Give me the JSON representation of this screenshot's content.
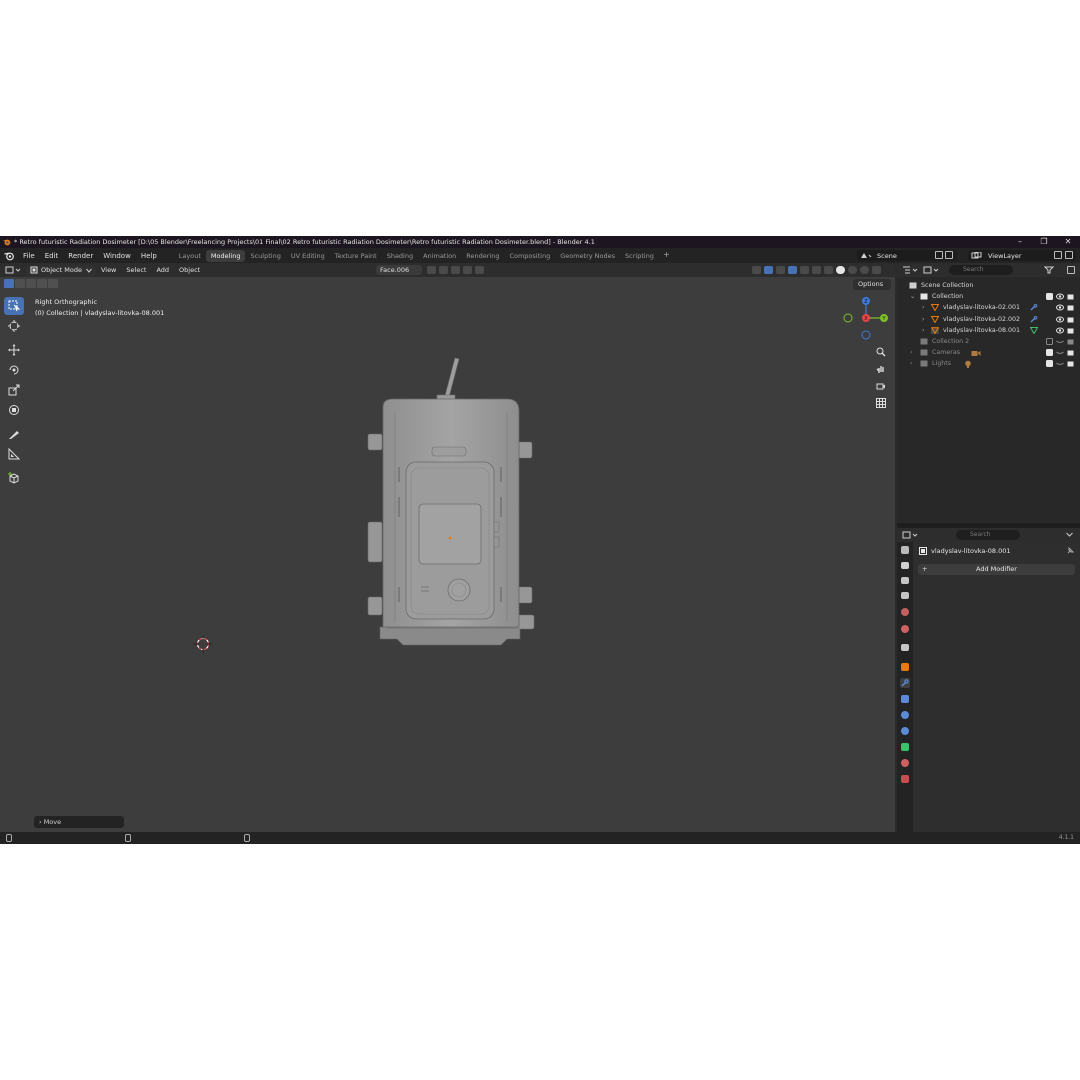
{
  "window": {
    "title": "* Retro futuristic Radiation Dosimeter [D:\\05 Blender\\Freelancing Projects\\01 Final\\02 Retro futuristic Radiation Dosimeter\\Retro futuristic Radiation Dosimeter.blend] - Blender 4.1",
    "controls": [
      "–",
      "❐",
      "✕"
    ]
  },
  "menu": [
    "File",
    "Edit",
    "Render",
    "Window",
    "Help"
  ],
  "workspaces": [
    "Layout",
    "Modeling",
    "Sculpting",
    "UV Editing",
    "Texture Paint",
    "Shading",
    "Animation",
    "Rendering",
    "Compositing",
    "Geometry Nodes",
    "Scripting"
  ],
  "active_workspace": "Modeling",
  "workspace_add": "+",
  "scene": "Scene",
  "view_layer": "ViewLayer",
  "viewport_header": {
    "mode": "Object Mode",
    "menus": [
      "View",
      "Select",
      "Add",
      "Object"
    ],
    "orientation": "Face.006"
  },
  "viewport": {
    "view_name": "Right Orthographic",
    "collection_info": "(0) Collection | vladyslav-litovka-08.001",
    "options_label": "Options",
    "last_operator": "Move",
    "gizmo": {
      "z": "Z",
      "y": "Y",
      "x": "X"
    }
  },
  "outliner": {
    "search_placeholder": "Search",
    "rows": [
      {
        "label": "Scene Collection",
        "dim": false
      },
      {
        "label": "Collection",
        "dim": false
      },
      {
        "label": "vladyslav-litovka-02.001",
        "dim": false
      },
      {
        "label": "vladyslav-litovka-02.002",
        "dim": false
      },
      {
        "label": "vladyslav-litovka-08.001",
        "dim": false
      },
      {
        "label": "Collection 2",
        "dim": true
      },
      {
        "label": "Cameras",
        "dim": true
      },
      {
        "label": "Lights",
        "dim": true
      }
    ]
  },
  "properties": {
    "search_placeholder": "Search",
    "object_name": "vladyslav-litovka-08.001",
    "add_modifier": "Add Modifier"
  },
  "status": {
    "version": "4.1.1"
  },
  "colors": {
    "accent": "#4772b3",
    "axis_x": "#e8444a",
    "axis_y": "#7fbf28",
    "axis_z": "#3e7ad8",
    "object_orange": "#e87d0d"
  }
}
